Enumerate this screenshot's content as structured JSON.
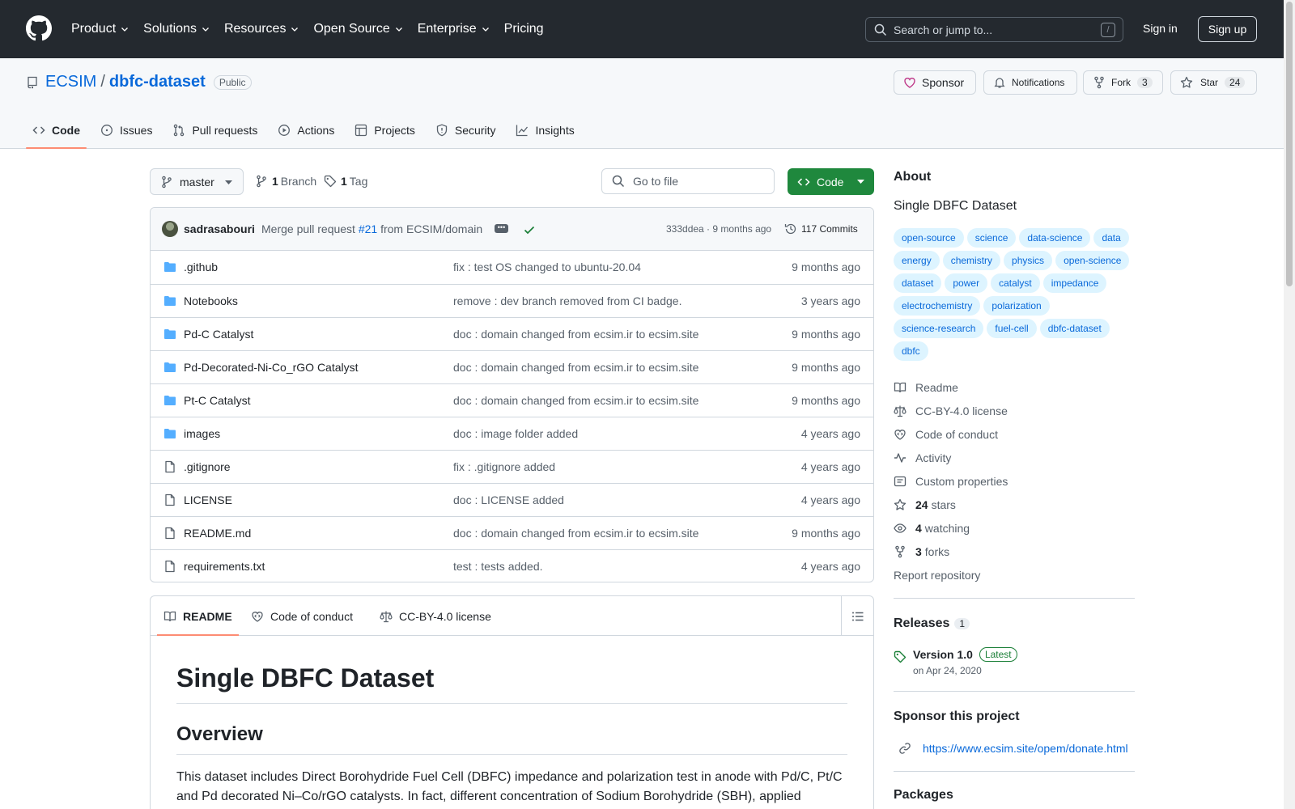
{
  "topnav": {
    "items": [
      "Product",
      "Solutions",
      "Resources",
      "Open Source",
      "Enterprise",
      "Pricing"
    ],
    "search_placeholder": "Search or jump to...",
    "search_shortcut": "/",
    "sign_in": "Sign in",
    "sign_up": "Sign up"
  },
  "repo": {
    "owner": "ECSIM",
    "separator": "/",
    "name": "dbfc-dataset",
    "visibility": "Public",
    "sponsor_label": "Sponsor",
    "notifications_label": "Notifications",
    "fork_label": "Fork",
    "fork_count": "3",
    "star_label": "Star",
    "star_count": "24"
  },
  "tabs": [
    {
      "label": "Code",
      "icon": "code-icon",
      "active": true
    },
    {
      "label": "Issues",
      "icon": "issue-icon",
      "active": false
    },
    {
      "label": "Pull requests",
      "icon": "pull-request-icon",
      "active": false
    },
    {
      "label": "Actions",
      "icon": "play-icon",
      "active": false
    },
    {
      "label": "Projects",
      "icon": "table-icon",
      "active": false
    },
    {
      "label": "Security",
      "icon": "shield-icon",
      "active": false
    },
    {
      "label": "Insights",
      "icon": "graph-icon",
      "active": false
    }
  ],
  "toolbar": {
    "branch": "master",
    "branch_count": "1",
    "branch_label": "Branch",
    "tag_count": "1",
    "tag_label": "Tag",
    "goto_placeholder": "Go to file",
    "code_label": "Code"
  },
  "commit": {
    "author": "sadrasabouri",
    "message_prefix": "Merge pull request",
    "pr_ref": "#21",
    "message_suffix": "from ECSIM/domain",
    "sha_and_time": "333ddea · 9 months ago",
    "commit_count": "117 Commits"
  },
  "files": [
    {
      "name": ".github",
      "type": "dir",
      "message": "fix : test OS changed to ubuntu-20.04",
      "date": "9 months ago"
    },
    {
      "name": "Notebooks",
      "type": "dir",
      "message": "remove : dev branch removed from CI badge.",
      "date": "3 years ago"
    },
    {
      "name": "Pd-C Catalyst",
      "type": "dir",
      "message": "doc : domain changed from ecsim.ir to ecsim.site",
      "date": "9 months ago"
    },
    {
      "name": "Pd-Decorated-Ni-Co_rGO Catalyst",
      "type": "dir",
      "message": "doc : domain changed from ecsim.ir to ecsim.site",
      "date": "9 months ago"
    },
    {
      "name": "Pt-C Catalyst",
      "type": "dir",
      "message": "doc : domain changed from ecsim.ir to ecsim.site",
      "date": "9 months ago"
    },
    {
      "name": "images",
      "type": "dir",
      "message": "doc : image folder added",
      "date": "4 years ago"
    },
    {
      "name": ".gitignore",
      "type": "file",
      "message": "fix : .gitignore added",
      "date": "4 years ago"
    },
    {
      "name": "LICENSE",
      "type": "file",
      "message": "doc : LICENSE added",
      "date": "4 years ago"
    },
    {
      "name": "README.md",
      "type": "file",
      "message": "doc : domain changed from ecsim.ir to ecsim.site",
      "date": "9 months ago"
    },
    {
      "name": "requirements.txt",
      "type": "file",
      "message": "test : tests added.",
      "date": "4 years ago"
    }
  ],
  "readme": {
    "tabs": [
      "README",
      "Code of conduct",
      "CC-BY-4.0 license"
    ],
    "title": "Single DBFC Dataset",
    "overview_heading": "Overview",
    "overview_text": "This dataset includes Direct Borohydride Fuel Cell (DBFC) impedance and polarization test in anode with Pd/C, Pt/C and Pd decorated Ni–Co/rGO catalysts. In fact, different concentration of Sodium Borohydride (SBH), applied"
  },
  "about": {
    "heading": "About",
    "description": "Single DBFC Dataset",
    "topics": [
      "open-source",
      "science",
      "data-science",
      "data",
      "energy",
      "chemistry",
      "physics",
      "open-science",
      "dataset",
      "power",
      "catalyst",
      "impedance",
      "electrochemistry",
      "polarization",
      "science-research",
      "fuel-cell",
      "dbfc-dataset",
      "dbfc"
    ],
    "links": [
      {
        "icon": "book-icon",
        "label": "Readme",
        "count": ""
      },
      {
        "icon": "law-icon",
        "label": "CC-BY-4.0 license",
        "count": ""
      },
      {
        "icon": "heart-code-icon",
        "label": "Code of conduct",
        "count": ""
      },
      {
        "icon": "pulse-icon",
        "label": "Activity",
        "count": ""
      },
      {
        "icon": "note-icon",
        "label": "Custom properties",
        "count": ""
      },
      {
        "icon": "star-icon",
        "label": "stars",
        "count": "24"
      },
      {
        "icon": "eye-icon",
        "label": "watching",
        "count": "4"
      },
      {
        "icon": "fork-icon",
        "label": "forks",
        "count": "3"
      }
    ],
    "report": "Report repository"
  },
  "releases": {
    "heading": "Releases",
    "count": "1",
    "version": "Version 1.0",
    "latest_label": "Latest",
    "date": "on Apr 24, 2020"
  },
  "sponsor": {
    "heading": "Sponsor this project",
    "url": "https://www.ecsim.site/opem/donate.html"
  },
  "packages": {
    "heading": "Packages"
  },
  "colors": {
    "header_bg": "#24292f",
    "link": "#0969da",
    "primary_button": "#1f883d",
    "active_tab_underline": "#fd8c73",
    "folder": "#54aeff",
    "topic_bg": "#ddf4ff"
  }
}
